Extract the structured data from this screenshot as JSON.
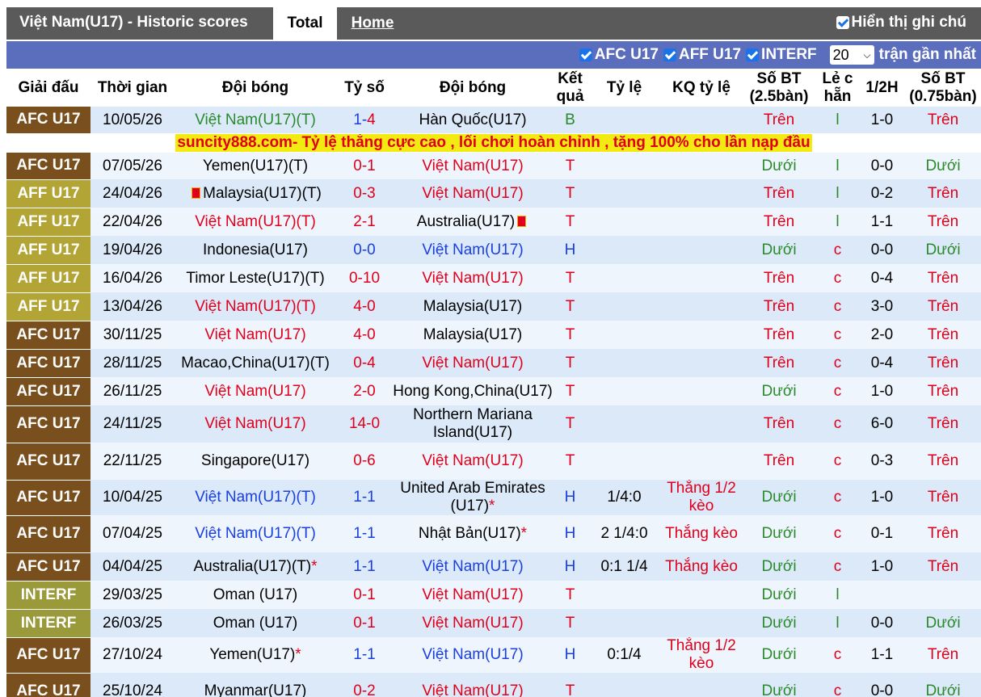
{
  "header": {
    "title": "Việt Nam(U17) - Historic scores",
    "tab_total": "Total",
    "tab_home": "Home",
    "show_tips": "Hiển thị ghi chú"
  },
  "filters": {
    "items": [
      "AFC U17",
      "AFF U17",
      "INTERF"
    ],
    "count": "20",
    "recent_label": "trận gần nhất"
  },
  "columns": [
    "Giải đấu",
    "Thời gian",
    "Đội bóng",
    "Tỷ số",
    "Đội bóng",
    "Kết quả",
    "Tỷ lệ",
    "KQ tỷ lệ",
    "Số BT (2.5bàn)",
    "Lẻ c hẵn",
    "1/2H",
    "Số BT (0.75bàn)"
  ],
  "ad": "suncity888.com- Tỷ lệ thắng cực cao , lối chơi hoàn chỉnh , tặng 100% cho lần nạp đầu",
  "rows": [
    {
      "league": "AFC U17",
      "date": "10/05/26",
      "home": "Việt Nam(U17)(T)",
      "score_a": "1",
      "score_b": "4",
      "away": "Hàn Quốc(U17)",
      "result": "B",
      "odds": "",
      "odds_result": "",
      "ou": "Trên",
      "oe": "l",
      "half": "1-0",
      "ou2": "Trên"
    },
    {
      "league": "AFC U17",
      "date": "07/05/26",
      "home": "Yemen(U17)(T)",
      "score_a": "0",
      "score_b": "1",
      "away": "Việt Nam(U17)",
      "result": "T",
      "odds": "",
      "odds_result": "",
      "ou": "Dưới",
      "oe": "l",
      "half": "0-0",
      "ou2": "Dưới"
    },
    {
      "league": "AFF U17",
      "date": "24/04/26",
      "home": "Malaysia(U17)(T)",
      "score_a": "0",
      "score_b": "3",
      "away": "Việt Nam(U17)",
      "result": "T",
      "odds": "",
      "odds_result": "",
      "ou": "Trên",
      "oe": "l",
      "half": "0-2",
      "ou2": "Trên"
    },
    {
      "league": "AFF U17",
      "date": "22/04/26",
      "home": "Việt Nam(U17)(T)",
      "score_a": "2",
      "score_b": "1",
      "away": "Australia(U17)",
      "result": "T",
      "odds": "",
      "odds_result": "",
      "ou": "Trên",
      "oe": "l",
      "half": "1-1",
      "ou2": "Trên"
    },
    {
      "league": "AFF U17",
      "date": "19/04/26",
      "home": "Indonesia(U17)",
      "score_a": "0",
      "score_b": "0",
      "away": "Việt Nam(U17)",
      "result": "H",
      "odds": "",
      "odds_result": "",
      "ou": "Dưới",
      "oe": "c",
      "half": "0-0",
      "ou2": "Dưới"
    },
    {
      "league": "AFF U17",
      "date": "16/04/26",
      "home": "Timor Leste(U17)(T)",
      "score_a": "0",
      "score_b": "10",
      "away": "Việt Nam(U17)",
      "result": "T",
      "odds": "",
      "odds_result": "",
      "ou": "Trên",
      "oe": "c",
      "half": "0-4",
      "ou2": "Trên"
    },
    {
      "league": "AFF U17",
      "date": "13/04/26",
      "home": "Việt Nam(U17)(T)",
      "score_a": "4",
      "score_b": "0",
      "away": "Malaysia(U17)",
      "result": "T",
      "odds": "",
      "odds_result": "",
      "ou": "Trên",
      "oe": "c",
      "half": "3-0",
      "ou2": "Trên"
    },
    {
      "league": "AFC U17",
      "date": "30/11/25",
      "home": "Việt Nam(U17)",
      "score_a": "4",
      "score_b": "0",
      "away": "Malaysia(U17)",
      "result": "T",
      "odds": "",
      "odds_result": "",
      "ou": "Trên",
      "oe": "c",
      "half": "2-0",
      "ou2": "Trên"
    },
    {
      "league": "AFC U17",
      "date": "28/11/25",
      "home": "Macao,China(U17)(T)",
      "score_a": "0",
      "score_b": "4",
      "away": "Việt Nam(U17)",
      "result": "T",
      "odds": "",
      "odds_result": "",
      "ou": "Trên",
      "oe": "c",
      "half": "0-4",
      "ou2": "Trên"
    },
    {
      "league": "AFC U17",
      "date": "26/11/25",
      "home": "Việt Nam(U17)",
      "score_a": "2",
      "score_b": "0",
      "away": "Hong Kong,China(U17)",
      "result": "T",
      "odds": "",
      "odds_result": "",
      "ou": "Dưới",
      "oe": "c",
      "half": "1-0",
      "ou2": "Trên"
    },
    {
      "league": "AFC U17",
      "date": "24/11/25",
      "home": "Việt Nam(U17)",
      "score_a": "14",
      "score_b": "0",
      "away": "Northern Mariana Island(U17)",
      "result": "T",
      "odds": "",
      "odds_result": "",
      "ou": "Trên",
      "oe": "c",
      "half": "6-0",
      "ou2": "Trên"
    },
    {
      "league": "AFC U17",
      "date": "22/11/25",
      "home": "Singapore(U17)",
      "score_a": "0",
      "score_b": "6",
      "away": "Việt Nam(U17)",
      "result": "T",
      "odds": "",
      "odds_result": "",
      "ou": "Trên",
      "oe": "c",
      "half": "0-3",
      "ou2": "Trên"
    },
    {
      "league": "AFC U17",
      "date": "10/04/25",
      "home": "Việt Nam(U17)(T)",
      "score_a": "1",
      "score_b": "1",
      "away": "United Arab Emirates (U17)",
      "result": "H",
      "odds": "1/4:0",
      "odds_result": "Thắng 1/2 kèo",
      "ou": "Dưới",
      "oe": "c",
      "half": "1-0",
      "ou2": "Trên"
    },
    {
      "league": "AFC U17",
      "date": "07/04/25",
      "home": "Việt Nam(U17)(T)",
      "score_a": "1",
      "score_b": "1",
      "away": "Nhật Bản(U17)",
      "result": "H",
      "odds": "2 1/4:0",
      "odds_result": "Thắng kèo",
      "ou": "Dưới",
      "oe": "c",
      "half": "0-1",
      "ou2": "Trên"
    },
    {
      "league": "AFC U17",
      "date": "04/04/25",
      "home": "Australia(U17)(T)",
      "score_a": "1",
      "score_b": "1",
      "away": "Việt Nam(U17)",
      "result": "H",
      "odds": "0:1 1/4",
      "odds_result": "Thắng kèo",
      "ou": "Dưới",
      "oe": "c",
      "half": "1-0",
      "ou2": "Trên"
    },
    {
      "league": "INTERF",
      "date": "29/03/25",
      "home": "Oman (U17)",
      "score_a": "0",
      "score_b": "1",
      "away": "Việt Nam(U17)",
      "result": "T",
      "odds": "",
      "odds_result": "",
      "ou": "Dưới",
      "oe": "l",
      "half": "",
      "ou2": ""
    },
    {
      "league": "INTERF",
      "date": "26/03/25",
      "home": "Oman (U17)",
      "score_a": "0",
      "score_b": "1",
      "away": "Việt Nam(U17)",
      "result": "T",
      "odds": "",
      "odds_result": "",
      "ou": "Dưới",
      "oe": "l",
      "half": "0-0",
      "ou2": "Dưới"
    },
    {
      "league": "AFC U17",
      "date": "27/10/24",
      "home": "Yemen(U17)",
      "score_a": "1",
      "score_b": "1",
      "away": "Việt Nam(U17)",
      "result": "H",
      "odds": "0:1/4",
      "odds_result": "Thắng 1/2 kèo",
      "ou": "Dưới",
      "oe": "c",
      "half": "1-1",
      "ou2": "Trên"
    },
    {
      "league": "AFC U17",
      "date": "25/10/24",
      "home": "Myanmar(U17)",
      "score_a": "0",
      "score_b": "2",
      "away": "Việt Nam(U17)",
      "result": "T",
      "odds": "",
      "odds_result": "",
      "ou": "Dưới",
      "oe": "c",
      "half": "0-0",
      "ou2": "Dưới"
    }
  ]
}
